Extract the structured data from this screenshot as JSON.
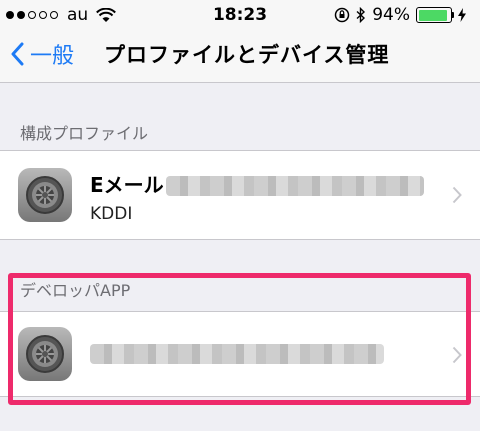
{
  "status_bar": {
    "carrier": "au",
    "time": "18:23",
    "battery_percent_label": "94%",
    "battery_level": 0.94,
    "signal_dots": [
      true,
      true,
      false,
      false,
      false
    ]
  },
  "nav": {
    "back_label": "一般",
    "title": "プロファイルとデバイス管理"
  },
  "sections": {
    "profiles_header": "構成プロファイル",
    "developer_header": "デベロッパAPP"
  },
  "profile_item": {
    "title": "Eメール",
    "subtitle": "KDDI"
  },
  "colors": {
    "accent": "#1e7bf5",
    "highlight": "#ee2a6b",
    "battery": "#4cd964"
  },
  "icons": [
    "wifi-icon",
    "orientation-lock-icon",
    "bluetooth-icon",
    "battery-icon",
    "charging-icon",
    "back-chevron-icon",
    "settings-gear-icon",
    "chevron-right-icon"
  ]
}
